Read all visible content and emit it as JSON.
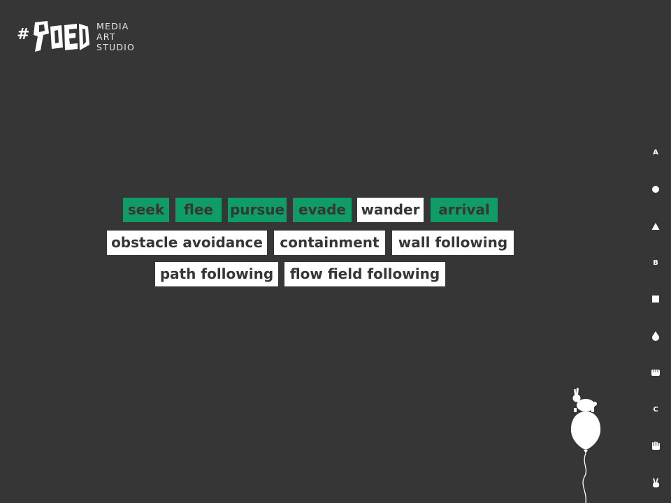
{
  "header": {
    "logo_text": "#90ED",
    "studio_lines": [
      "MEDIA",
      "ART",
      "STUDIO"
    ]
  },
  "colors": {
    "background": "#363636",
    "active_tag": "#0f9c67",
    "inactive_tag": "#ffffff"
  },
  "behaviors": {
    "row1": [
      {
        "label": "seek",
        "state": "active"
      },
      {
        "label": "flee",
        "state": "active"
      },
      {
        "label": "pursue",
        "state": "active"
      },
      {
        "label": "evade",
        "state": "active"
      },
      {
        "label": "wander",
        "state": "inactive"
      },
      {
        "label": "arrival",
        "state": "active"
      }
    ],
    "row2": [
      {
        "label": "obstacle avoidance",
        "state": "inactive"
      },
      {
        "label": "containment",
        "state": "inactive"
      },
      {
        "label": "wall following",
        "state": "inactive"
      }
    ],
    "row3": [
      {
        "label": "path following",
        "state": "inactive"
      },
      {
        "label": "flow field following",
        "state": "inactive"
      }
    ]
  },
  "side_nav": [
    {
      "label": "A",
      "icon": "letter-a"
    },
    {
      "label": "",
      "icon": "circle-icon"
    },
    {
      "label": "",
      "icon": "triangle-icon"
    },
    {
      "label": "B",
      "icon": "letter-b"
    },
    {
      "label": "",
      "icon": "square-icon"
    },
    {
      "label": "",
      "icon": "drop-icon"
    },
    {
      "label": "",
      "icon": "fist-icon"
    },
    {
      "label": "C",
      "icon": "letter-c"
    },
    {
      "label": "",
      "icon": "open-hand-icon"
    },
    {
      "label": "",
      "icon": "victory-hand-icon"
    }
  ]
}
